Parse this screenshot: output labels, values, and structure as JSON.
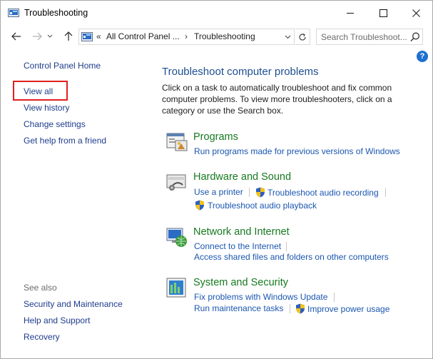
{
  "window": {
    "title": "Troubleshooting"
  },
  "nav": {
    "address_part1": "All Control Panel ...",
    "address_part2": "Troubleshooting",
    "chevron": "«",
    "separator": "›",
    "search_placeholder": "Search Troubleshoot..."
  },
  "help": {
    "label": "?"
  },
  "sidebar": {
    "items": [
      {
        "label": "Control Panel Home"
      },
      {
        "label": "View all"
      },
      {
        "label": "View history"
      },
      {
        "label": "Change settings"
      },
      {
        "label": "Get help from a friend"
      }
    ],
    "see_also_title": "See also",
    "see_also": [
      {
        "label": "Security and Maintenance"
      },
      {
        "label": "Help and Support"
      },
      {
        "label": "Recovery"
      }
    ]
  },
  "main": {
    "title": "Troubleshoot computer problems",
    "description": "Click on a task to automatically troubleshoot and fix common computer problems. To view more troubleshooters, click on a category or use the Search box.",
    "categories": [
      {
        "title": "Programs",
        "icon": "programs-icon",
        "tasks": [
          {
            "label": "Run programs made for previous versions of Windows"
          }
        ]
      },
      {
        "title": "Hardware and Sound",
        "icon": "hardware-sound-icon",
        "tasks": [
          {
            "label": "Use a printer"
          },
          {
            "label": "Troubleshoot audio recording"
          },
          {
            "label": "Troubleshoot audio playback"
          }
        ]
      },
      {
        "title": "Network and Internet",
        "icon": "network-internet-icon",
        "tasks": [
          {
            "label": "Connect to the Internet"
          },
          {
            "label": "Access shared files and folders on other computers"
          }
        ]
      },
      {
        "title": "System and Security",
        "icon": "system-security-icon",
        "tasks": [
          {
            "label": "Fix problems with Windows Update"
          },
          {
            "label": "Run maintenance tasks"
          },
          {
            "label": "Improve power usage"
          }
        ]
      }
    ]
  },
  "colors": {
    "link": "#1a56b0",
    "category": "#167a1f",
    "heading": "#1d4f91",
    "highlight": "#e0201f"
  }
}
